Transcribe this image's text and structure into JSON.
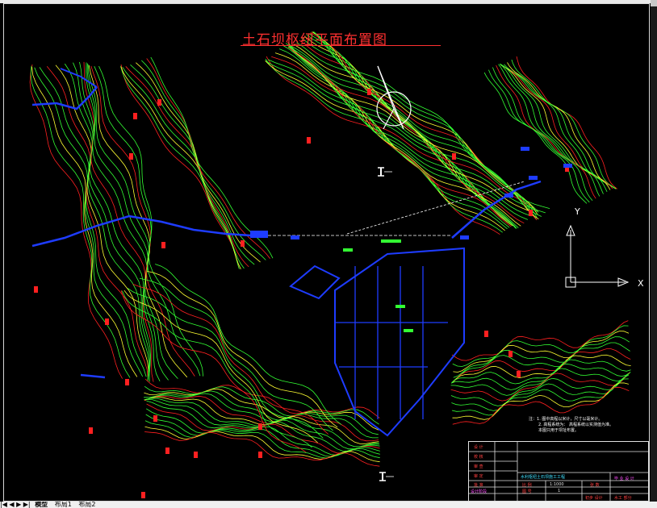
{
  "drawing": {
    "title": "土石坝枢纽平面布置图",
    "axis_labels": {
      "x": "X",
      "y": "Y"
    },
    "notes": {
      "prefix": "注：",
      "lines": [
        "1. 图中高程以米计，尺寸以毫米计。",
        "2. 高程系统为：  高程系统以实测值为准。",
        "本图只用于坝址布置。"
      ]
    }
  },
  "title_block": {
    "left_labels": [
      "设 计",
      "校 核",
      "审 查",
      "审 定",
      "批 准",
      "设计阶段"
    ],
    "project_name": "水利枢纽土石坝施工工程",
    "stamp": "毕 业 设 计",
    "scale_label": "比 例",
    "scale_value": "1:1000",
    "count_label": "张 数",
    "count_value": "1",
    "ratio_label": "图 号",
    "design_label": "初步 设计",
    "role_label": "水工 部分"
  },
  "layout_tabs": {
    "items": [
      "模型",
      "布局1",
      "布局2"
    ],
    "active_index": 0
  },
  "colors": {
    "background": "#000000",
    "contour_green": "#33ff33",
    "contour_yellow": "#ffff33",
    "contour_red": "#ff2020",
    "structure_blue": "#1e3cff",
    "annotation_white": "#ffffff",
    "title_red": "#ff3030"
  }
}
